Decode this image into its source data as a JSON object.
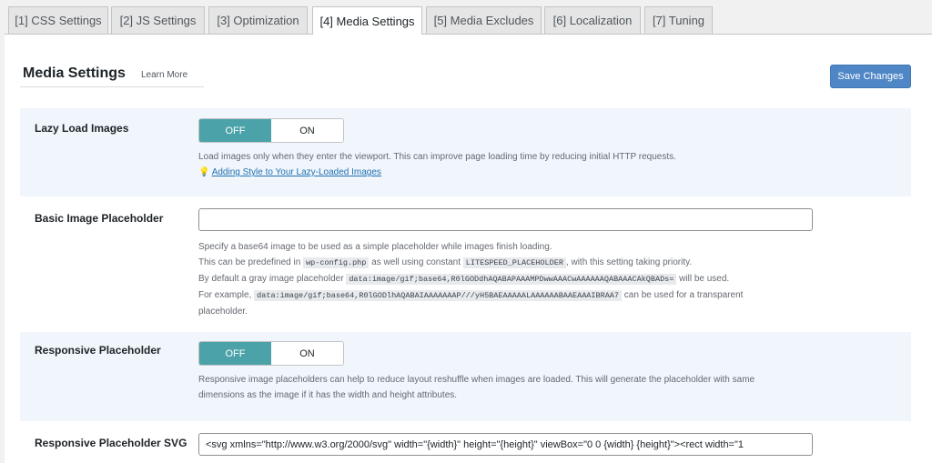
{
  "tabs": [
    {
      "label": "[1] CSS Settings"
    },
    {
      "label": "[2] JS Settings"
    },
    {
      "label": "[3] Optimization"
    },
    {
      "label": "[4] Media Settings"
    },
    {
      "label": "[5] Media Excludes"
    },
    {
      "label": "[6] Localization"
    },
    {
      "label": "[7] Tuning"
    }
  ],
  "active_tab": "[4] Media Settings",
  "header": {
    "title": "Media Settings",
    "learn_more": "Learn More",
    "save_button": "Save Changes"
  },
  "colors": {
    "accent": "#4f87c6",
    "toggle_off": "#4ba3a9",
    "row_shade": "#f0f6fc",
    "link": "#2271b1"
  },
  "settings": {
    "lazy_load": {
      "label": "Lazy Load Images",
      "off": "OFF",
      "on": "ON",
      "selected": "OFF",
      "description": "Load images only when they enter the viewport. This can improve page loading time by reducing initial HTTP requests.",
      "icon": "lightbulb-icon",
      "link": "Adding Style to Your Lazy-Loaded Images"
    },
    "placeholder": {
      "label": "Basic Image Placeholder",
      "value": "",
      "line1": "Specify a base64 image to be used as a simple placeholder while images finish loading.",
      "line2_a": "This can be predefined in",
      "line2_code1": "wp-config.php",
      "line2_b": "as well using constant",
      "line2_code2": "LITESPEED_PLACEHOLDER",
      "line2_c": ", with this setting taking priority.",
      "line3_a": "By default a gray image placeholder",
      "line3_code": "data:image/gif;base64,R0lGODdhAQABAPAAAMPDwwAAACwAAAAAAQABAAACAkQBADs=",
      "line3_b": "will be used.",
      "line4_a": "For example,",
      "line4_code": "data:image/gif;base64,R0lGODlhAQABAIAAAAAAAP///yH5BAEAAAAALAAAAAABAAEAAAIBRAA7",
      "line4_b": "can be used for a transparent",
      "line5": "placeholder."
    },
    "responsive": {
      "label": "Responsive Placeholder",
      "off": "OFF",
      "on": "ON",
      "selected": "OFF",
      "line1": "Responsive image placeholders can help to reduce layout reshuffle when images are loaded. This will generate the placeholder with same",
      "line2": "dimensions as the image if it has the width and height attributes."
    },
    "svg": {
      "label": "Responsive Placeholder SVG",
      "value": "<svg xmlns=\"http://www.w3.org/2000/svg\" width=\"{width}\" height=\"{height}\" viewBox=\"0 0 {width} {height}\"><rect width=\"1"
    }
  }
}
